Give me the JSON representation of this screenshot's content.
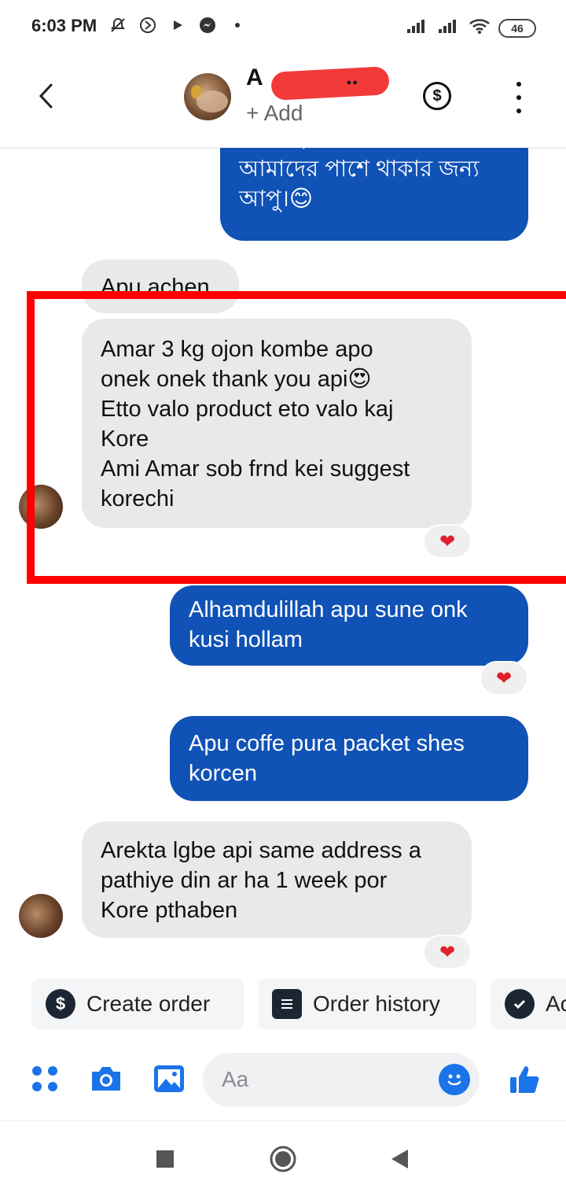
{
  "status_bar": {
    "time": "6:03 PM",
    "left_icons": [
      "mute-icon",
      "circle-arrow-icon",
      "play-icon",
      "messenger-icon",
      "dot-icon"
    ],
    "battery": "46"
  },
  "header": {
    "name_visible": "A",
    "name_suffix": "..",
    "subtitle": "+ Add"
  },
  "messages": [
    {
      "direction": "outgoing",
      "text": "আ শাইর অনেক ধন্যবাদ\nআমাদের পাশে থাকার জন্য\nআপু।😊"
    },
    {
      "direction": "incoming",
      "text": "Apu achen"
    },
    {
      "direction": "incoming",
      "text": "Amar 3 kg ojon kombe apo\nonek onek thank you api😍\nEtto valo product eto valo kaj\nKore\nAmi Amar sob frnd kei suggest\nkorechi",
      "reaction": "❤"
    },
    {
      "direction": "outgoing",
      "text": "Alhamdulillah apu sune onk\nkusi hollam",
      "reaction": "❤"
    },
    {
      "direction": "outgoing",
      "text": "Apu coffe pura packet shes\nkorcen"
    },
    {
      "direction": "incoming",
      "text": "Arekta lgbe api same address a\npathiye din ar ha 1 week por\nKore pthaben",
      "reaction": "❤"
    }
  ],
  "quick_actions": [
    {
      "label": "Create order",
      "icon": "dollar-icon"
    },
    {
      "label": "Order history",
      "icon": "list-icon"
    },
    {
      "label": "Ac",
      "icon": "check-icon"
    }
  ],
  "composer": {
    "placeholder": "Aa"
  },
  "colors": {
    "outgoing_bubble": "#1052b5",
    "incoming_bubble": "#e9e9eb",
    "accent": "#1a73e8",
    "highlight": "#ff0000",
    "heart": "#e0202c"
  }
}
